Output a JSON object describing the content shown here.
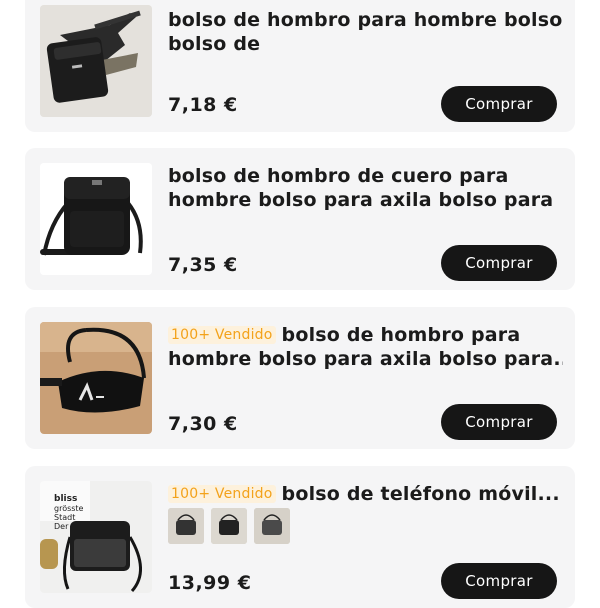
{
  "products": [
    {
      "title_lines": [
        "bolso de hombro para hombre bolso",
        "bolso de"
      ],
      "price": "7,18 €",
      "buy_label": "Comprar"
    },
    {
      "title_lines": [
        "bolso de hombro de cuero para",
        "hombre bolso para axila bolso para"
      ],
      "price": "7,35 €",
      "buy_label": "Comprar"
    },
    {
      "badge": "100+ Vendido",
      "title_lines": [
        "bolso de hombro para",
        "hombre bolso para axila bolso para..."
      ],
      "price": "7,30 €",
      "buy_label": "Comprar"
    },
    {
      "badge": "100+ Vendido",
      "title_lines": [
        "bolso de teléfono móvil..."
      ],
      "price": "13,99 €",
      "buy_label": "Comprar",
      "image_sign_text": "bliss grösste Stadt Der"
    }
  ]
}
